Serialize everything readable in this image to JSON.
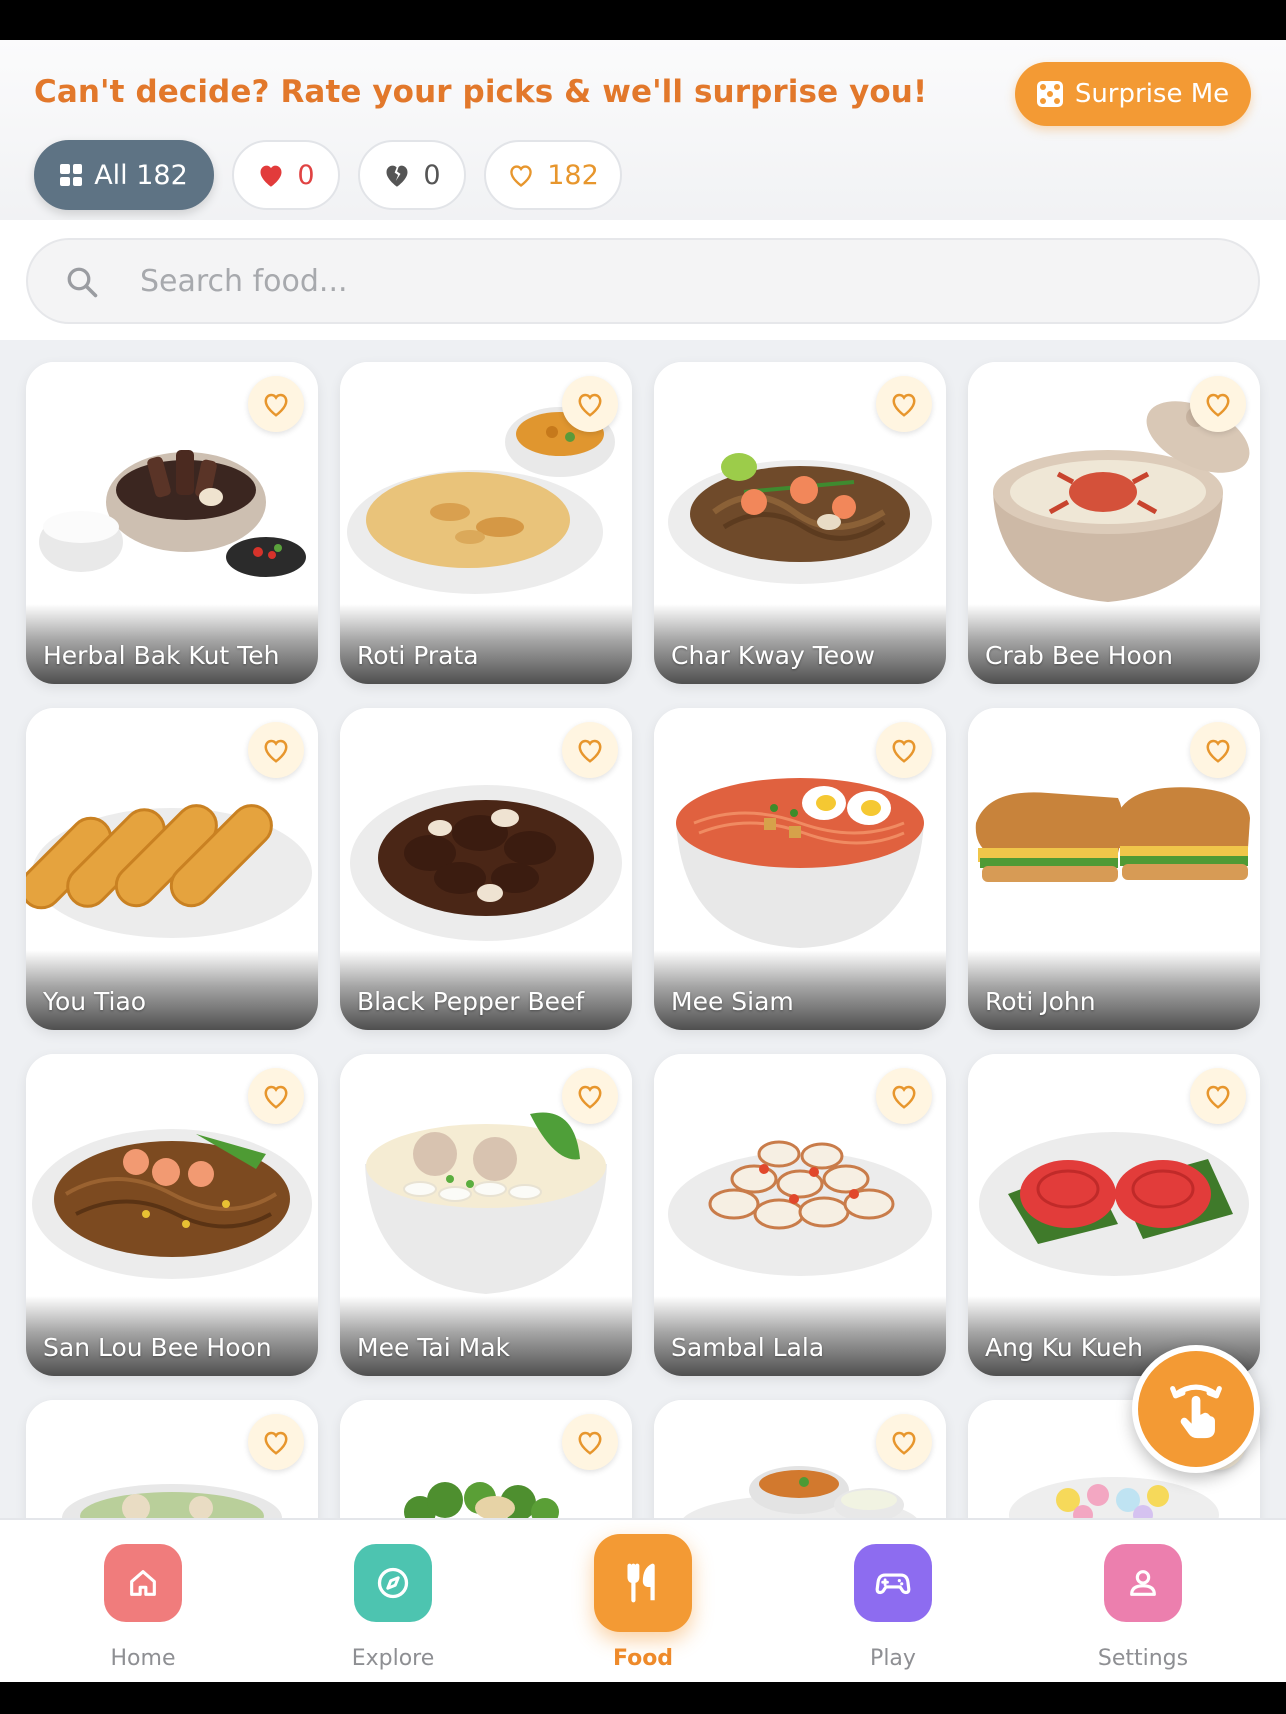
{
  "header": {
    "tagline": "Can't decide? Rate your picks & we'll surprise you!",
    "surprise_label": "Surprise Me"
  },
  "filters": {
    "all_label": "All 182",
    "love_count": "0",
    "dislike_count": "0",
    "like_count": "182"
  },
  "search": {
    "placeholder": "Search food..."
  },
  "foods": [
    {
      "name": "Herbal Bak Kut Teh",
      "icon": "bak-kut-teh-image"
    },
    {
      "name": "Roti Prata",
      "icon": "roti-prata-image"
    },
    {
      "name": "Char Kway Teow",
      "icon": "char-kway-teow-image"
    },
    {
      "name": "Crab Bee Hoon",
      "icon": "crab-bee-hoon-image"
    },
    {
      "name": "You Tiao",
      "icon": "you-tiao-image"
    },
    {
      "name": "Black Pepper Beef",
      "icon": "black-pepper-beef-image"
    },
    {
      "name": "Mee Siam",
      "icon": "mee-siam-image"
    },
    {
      "name": "Roti John",
      "icon": "roti-john-image"
    },
    {
      "name": "San Lou Bee Hoon",
      "icon": "san-lou-bee-hoon-image"
    },
    {
      "name": "Mee Tai Mak",
      "icon": "mee-tai-mak-image"
    },
    {
      "name": "Sambal Lala",
      "icon": "sambal-lala-image"
    },
    {
      "name": "Ang Ku Kueh",
      "icon": "ang-ku-kueh-image"
    }
  ],
  "nav": {
    "home": "Home",
    "explore": "Explore",
    "food": "Food",
    "play": "Play",
    "settings": "Settings"
  },
  "colors": {
    "accent": "#f39a34",
    "tagline": "#e2782b",
    "chip_active": "#5e7384",
    "home": "#f07c7c",
    "explore": "#4dc4b0",
    "play": "#8d6cf0",
    "settings": "#ec7fae"
  }
}
